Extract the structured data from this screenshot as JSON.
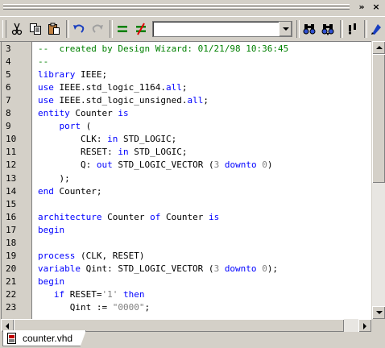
{
  "window": {
    "controls": {
      "chevron": "»",
      "close": "×"
    }
  },
  "toolbar": {
    "icons": [
      "cut-icon",
      "copy-icon",
      "paste-icon",
      "undo-icon",
      "redo-icon",
      "compare-icon",
      "not-equal-icon",
      "find-icon",
      "find-next-icon",
      "bookmark-icon",
      "tool-icon"
    ],
    "combo_value": ""
  },
  "editor": {
    "lines": [
      {
        "n": "3",
        "tokens": [
          {
            "t": "--  created by Design Wizard: 01/21/98 10:36:45",
            "c": "cm"
          }
        ]
      },
      {
        "n": "4",
        "tokens": [
          {
            "t": "--",
            "c": "cm"
          }
        ]
      },
      {
        "n": "5",
        "tokens": [
          {
            "t": "library",
            "c": "kw"
          },
          {
            "t": " IEEE;",
            "c": ""
          }
        ]
      },
      {
        "n": "6",
        "tokens": [
          {
            "t": "use",
            "c": "kw"
          },
          {
            "t": " IEEE.std_logic_1164.",
            "c": ""
          },
          {
            "t": "all",
            "c": "kw"
          },
          {
            "t": ";",
            "c": ""
          }
        ]
      },
      {
        "n": "7",
        "tokens": [
          {
            "t": "use",
            "c": "kw"
          },
          {
            "t": " IEEE.std_logic_unsigned.",
            "c": ""
          },
          {
            "t": "all",
            "c": "kw"
          },
          {
            "t": ";",
            "c": ""
          }
        ]
      },
      {
        "n": "8",
        "tokens": [
          {
            "t": "entity",
            "c": "kw"
          },
          {
            "t": " Counter ",
            "c": ""
          },
          {
            "t": "is",
            "c": "kw"
          }
        ]
      },
      {
        "n": "9",
        "tokens": [
          {
            "t": "    ",
            "c": ""
          },
          {
            "t": "port",
            "c": "kw"
          },
          {
            "t": " (",
            "c": ""
          }
        ]
      },
      {
        "n": "10",
        "tokens": [
          {
            "t": "        CLK: ",
            "c": ""
          },
          {
            "t": "in",
            "c": "kw"
          },
          {
            "t": " STD_LOGIC;",
            "c": ""
          }
        ]
      },
      {
        "n": "11",
        "tokens": [
          {
            "t": "        RESET: ",
            "c": ""
          },
          {
            "t": "in",
            "c": "kw"
          },
          {
            "t": " STD_LOGIC;",
            "c": ""
          }
        ]
      },
      {
        "n": "12",
        "tokens": [
          {
            "t": "        Q: ",
            "c": ""
          },
          {
            "t": "out",
            "c": "kw"
          },
          {
            "t": " STD_LOGIC_VECTOR (",
            "c": ""
          },
          {
            "t": "3",
            "c": "num"
          },
          {
            "t": " ",
            "c": ""
          },
          {
            "t": "downto",
            "c": "kw"
          },
          {
            "t": " ",
            "c": ""
          },
          {
            "t": "0",
            "c": "num"
          },
          {
            "t": ")",
            "c": ""
          }
        ]
      },
      {
        "n": "13",
        "tokens": [
          {
            "t": "    );",
            "c": ""
          }
        ]
      },
      {
        "n": "14",
        "tokens": [
          {
            "t": "end",
            "c": "kw"
          },
          {
            "t": " Counter;",
            "c": ""
          }
        ]
      },
      {
        "n": "15",
        "tokens": []
      },
      {
        "n": "16",
        "tokens": [
          {
            "t": "architecture",
            "c": "kw"
          },
          {
            "t": " Counter ",
            "c": ""
          },
          {
            "t": "of",
            "c": "kw"
          },
          {
            "t": " Counter ",
            "c": ""
          },
          {
            "t": "is",
            "c": "kw"
          }
        ]
      },
      {
        "n": "17",
        "tokens": [
          {
            "t": "begin",
            "c": "kw"
          }
        ]
      },
      {
        "n": "18",
        "tokens": []
      },
      {
        "n": "19",
        "tokens": [
          {
            "t": "process",
            "c": "kw"
          },
          {
            "t": " (CLK, RESET)",
            "c": ""
          }
        ]
      },
      {
        "n": "20",
        "tokens": [
          {
            "t": "variable",
            "c": "kw"
          },
          {
            "t": " Qint: STD_LOGIC_VECTOR (",
            "c": ""
          },
          {
            "t": "3",
            "c": "num"
          },
          {
            "t": " ",
            "c": ""
          },
          {
            "t": "downto",
            "c": "kw"
          },
          {
            "t": " ",
            "c": ""
          },
          {
            "t": "0",
            "c": "num"
          },
          {
            "t": ");",
            "c": ""
          }
        ]
      },
      {
        "n": "21",
        "tokens": [
          {
            "t": "begin",
            "c": "kw"
          }
        ]
      },
      {
        "n": "22",
        "tokens": [
          {
            "t": "   ",
            "c": ""
          },
          {
            "t": "if",
            "c": "kw"
          },
          {
            "t": " RESET=",
            "c": ""
          },
          {
            "t": "'1'",
            "c": "str"
          },
          {
            "t": " ",
            "c": ""
          },
          {
            "t": "then",
            "c": "kw"
          }
        ]
      },
      {
        "n": "23",
        "tokens": [
          {
            "t": "      Qint := ",
            "c": ""
          },
          {
            "t": "\"0000\"",
            "c": "str"
          },
          {
            "t": ";",
            "c": ""
          }
        ]
      }
    ]
  },
  "tabs": [
    {
      "label": "counter.vhd",
      "icon": "vhdl-file-icon"
    }
  ]
}
